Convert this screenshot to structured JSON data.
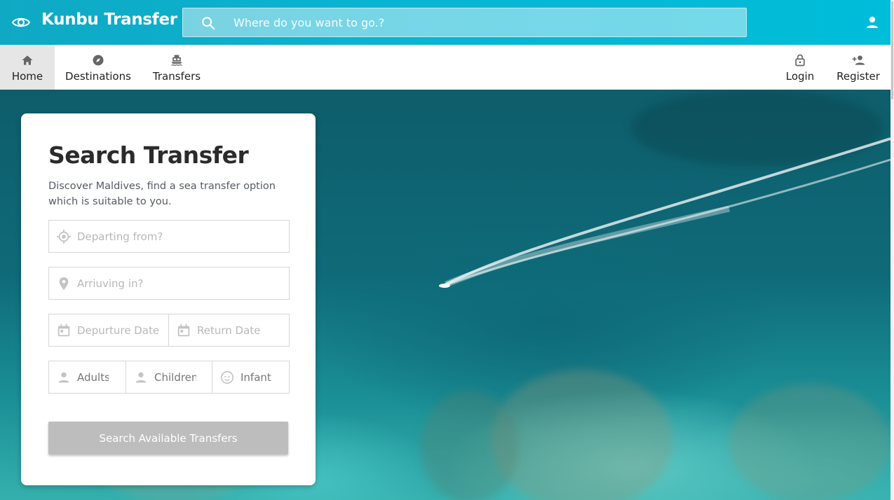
{
  "header": {
    "brand": "Kunbu Transfer",
    "search_placeholder": "Where do you want to go.?"
  },
  "nav": {
    "home": "Home",
    "destinations": "Destinations",
    "transfers": "Transfers",
    "login": "Login",
    "register": "Register"
  },
  "card": {
    "title": "Search Transfer",
    "description": "Discover Maldives, find a sea transfer option which is suitable to you.",
    "departing_placeholder": "Departing from?",
    "arriving_placeholder": "Arriuving in?",
    "departure_date_placeholder": "Depurture Date",
    "return_date_placeholder": "Return Date",
    "adults_placeholder": "Adults",
    "children_placeholder": "Children",
    "infant_placeholder": "Infant",
    "search_button": "Search Available Transfers"
  },
  "colors": {
    "header_bg": "#00bdd8",
    "active_nav_bg": "#e6e6e6",
    "button_disabled": "#bdbdbd"
  },
  "icons": {
    "logo": "eye-icon",
    "search": "search-icon",
    "user": "account-icon",
    "home": "home-icon",
    "destinations": "compass-icon",
    "transfers": "ferry-icon",
    "login": "lock-icon",
    "register": "person-add-icon",
    "departing": "crosshair-icon",
    "arriving": "map-pin-icon",
    "date": "calendar-icon",
    "adults": "person-icon",
    "children": "person-icon",
    "infant": "baby-face-icon"
  }
}
